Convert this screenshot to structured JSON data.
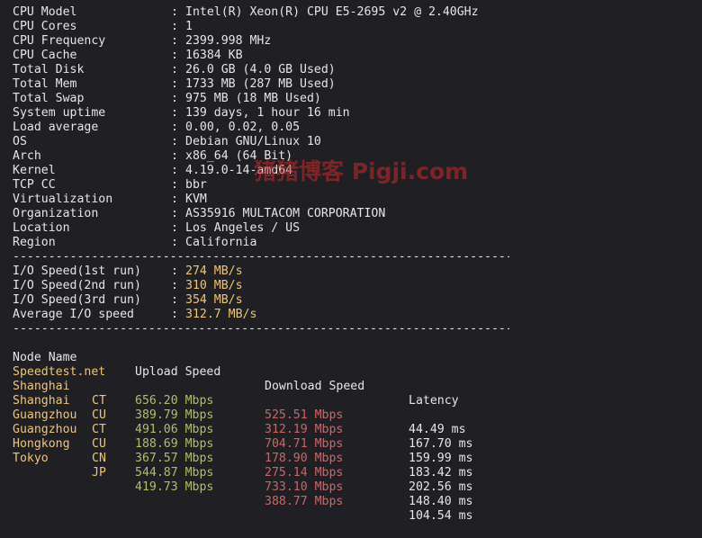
{
  "system_info": [
    {
      "label": "CPU Model",
      "value": "Intel(R) Xeon(R) CPU E5-2695 v2 @ 2.40GHz"
    },
    {
      "label": "CPU Cores",
      "value": "1"
    },
    {
      "label": "CPU Frequency",
      "value": "2399.998 MHz"
    },
    {
      "label": "CPU Cache",
      "value": "16384 KB"
    },
    {
      "label": "Total Disk",
      "value": "26.0 GB (4.0 GB Used)"
    },
    {
      "label": "Total Mem",
      "value": "1733 MB (287 MB Used)"
    },
    {
      "label": "Total Swap",
      "value": "975 MB (18 MB Used)"
    },
    {
      "label": "System uptime",
      "value": "139 days, 1 hour 16 min"
    },
    {
      "label": "Load average",
      "value": "0.00, 0.02, 0.05"
    },
    {
      "label": "OS",
      "value": "Debian GNU/Linux 10"
    },
    {
      "label": "Arch",
      "value": "x86_64 (64 Bit)"
    },
    {
      "label": "Kernel",
      "value": "4.19.0-14-amd64"
    },
    {
      "label": "TCP CC",
      "value": "bbr"
    },
    {
      "label": "Virtualization",
      "value": "KVM"
    },
    {
      "label": "Organization",
      "value": "AS35916 MULTACOM CORPORATION"
    },
    {
      "label": "Location",
      "value": "Los Angeles / US"
    },
    {
      "label": "Region",
      "value": "California"
    }
  ],
  "separator": "------------------------------------------------------------------------------",
  "colon": ":",
  "io_speed": [
    {
      "label": "I/O Speed(1st run)",
      "value": "274 MB/s"
    },
    {
      "label": "I/O Speed(2nd run)",
      "value": "310 MB/s"
    },
    {
      "label": "I/O Speed(3rd run)",
      "value": "354 MB/s"
    },
    {
      "label": "Average I/O speed",
      "value": "312.7 MB/s"
    }
  ],
  "speed_table": {
    "headers": {
      "node": "Node Name",
      "upload": "Upload Speed",
      "download": "Download Speed",
      "latency": "Latency"
    },
    "rows": [
      {
        "node": "Speedtest.net",
        "code": "",
        "upload": "656.20 Mbps",
        "download": "525.51 Mbps",
        "latency": "44.49 ms"
      },
      {
        "node": "Shanghai",
        "code": "CT",
        "upload": "389.79 Mbps",
        "download": "312.19 Mbps",
        "latency": "167.70 ms"
      },
      {
        "node": "Shanghai",
        "code": "CU",
        "upload": "491.06 Mbps",
        "download": "704.71 Mbps",
        "latency": "159.99 ms"
      },
      {
        "node": "Guangzhou",
        "code": "CT",
        "upload": "188.69 Mbps",
        "download": "178.90 Mbps",
        "latency": "183.42 ms"
      },
      {
        "node": "Guangzhou",
        "code": "CU",
        "upload": "367.57 Mbps",
        "download": "275.14 Mbps",
        "latency": "202.56 ms"
      },
      {
        "node": "Hongkong",
        "code": "CN",
        "upload": "544.87 Mbps",
        "download": "733.10 Mbps",
        "latency": "148.40 ms"
      },
      {
        "node": "Tokyo",
        "code": "JP",
        "upload": "419.73 Mbps",
        "download": "388.77 Mbps",
        "latency": "104.54 ms"
      }
    ]
  },
  "watermark": "猪猪博客 Pigji.com",
  "colors": {
    "background": "#1f1f24",
    "text": "#e6e6e6",
    "yellow": "#f0c674",
    "green": "#b5bd68",
    "red": "#cc6666",
    "watermark": "#c82828"
  }
}
